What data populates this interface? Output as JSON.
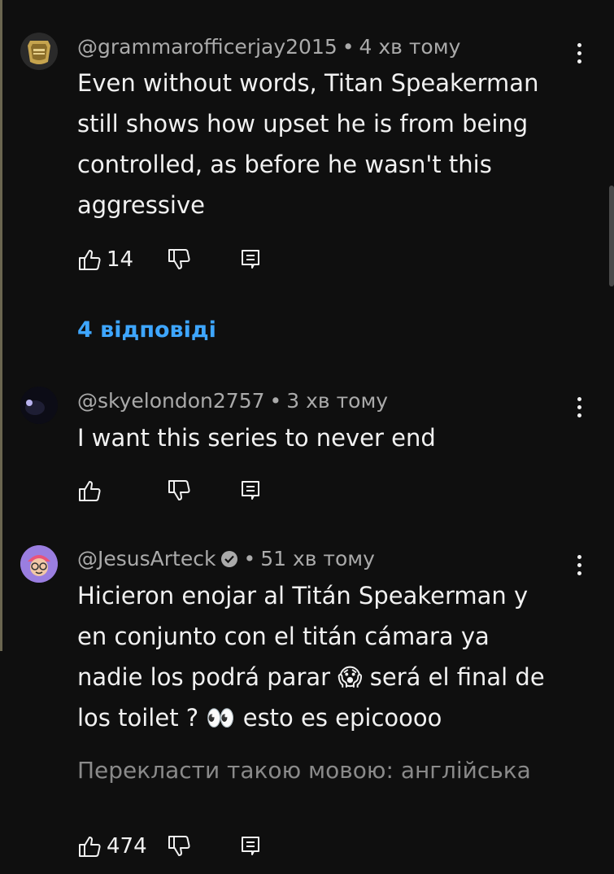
{
  "comments": [
    {
      "author": "@grammarofficerjay2015",
      "time": "4 хв тому",
      "lines": [
        "Even without words, Titan Speakerman",
        "still shows how upset he is from being",
        "controlled, as before he wasn't this",
        "aggressive"
      ],
      "likes": "14",
      "replies": "4 відповіді",
      "avatar_icon": "police-badge-icon"
    },
    {
      "author": "@skyelondon2757",
      "time": "3 хв тому",
      "lines": [
        "I want this series to never end"
      ],
      "likes": "",
      "avatar_icon": "dark-photo-avatar"
    },
    {
      "author": "@JesusArteck",
      "verified": true,
      "time": "51 хв тому",
      "lines": [
        "Hicieron enojar al Titán Speakerman y",
        "en conjunto con el titán cámara ya",
        "nadie los podrá parar 😱 será el final de",
        "los toilet ? 👀 esto es epicoooo"
      ],
      "translate": "Перекласти такою мовою: англійська",
      "likes": "474",
      "avatar_icon": "cartoon-avatar"
    }
  ],
  "separator": "•",
  "colors": {
    "background": "#0f0f0f",
    "text": "#f1f1f1",
    "meta": "#aaaaaa",
    "link": "#3ea6ff"
  }
}
